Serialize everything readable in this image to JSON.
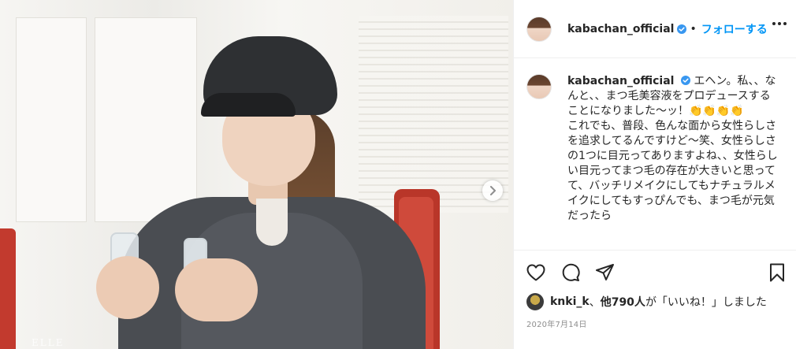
{
  "post": {
    "username": "kabachan_official",
    "follow_label": "フォローする",
    "separator": "•"
  },
  "caption": {
    "username": "kabachan_official",
    "line1": "エヘン。私、、なんと、、まつ毛美容液をプロデュースすることになりました〜ッ！👏👏👏👏",
    "line2": "これでも、普段、色んな面から女性らしさを追求してるんですけど〜笑、女性らしさの1つに目元ってありますよね、、女性らしい目元ってまつ毛の存在が大きいと思ってて、バッチリメイクにしてもナチュラルメイクにしてもすっぴんでも、まつ毛が元気だったら"
  },
  "likes": {
    "user": "knki_k",
    "sep": "、",
    "count": "他790人",
    "text": "が「いいね！」しました"
  },
  "date": "2020年7月14日",
  "media": {
    "watermark": "ELLE"
  },
  "icons": {
    "verified": "verified-badge-icon",
    "more": "more-options-icon",
    "next": "chevron-right-icon",
    "like": "heart-icon",
    "comment": "comment-icon",
    "share": "share-icon",
    "save": "bookmark-icon"
  },
  "colors": {
    "link": "#0095f6",
    "verified": "#3897f0",
    "text": "#262626",
    "muted": "#8e8e8e"
  }
}
